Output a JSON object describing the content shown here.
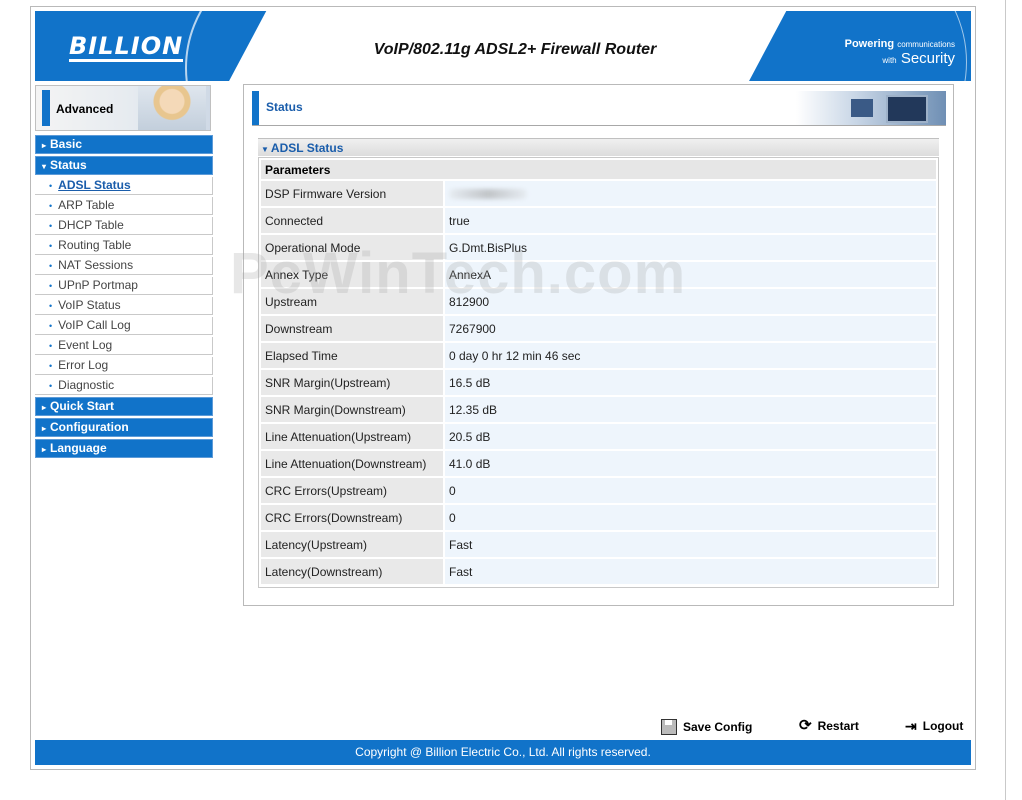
{
  "colors": {
    "brand_blue": "#1173c9",
    "link_blue": "#1a5dab",
    "value_bg": "#eef5fc",
    "label_bg": "#e9e9e9"
  },
  "header": {
    "logo": "BILLION",
    "title": "VoIP/802.11g ADSL2+ Firewall Router",
    "slogan_line1_bold": "Powering",
    "slogan_line1_small": "communications",
    "slogan_line2_small": "with",
    "slogan_line2_big": "Security"
  },
  "sidebar": {
    "mode_label": "Advanced",
    "items": [
      {
        "label": "Basic",
        "type": "main",
        "arrow": "▸"
      },
      {
        "label": "Status",
        "type": "main",
        "arrow": "▾"
      },
      {
        "label": "ADSL Status",
        "type": "sub",
        "active": true
      },
      {
        "label": "ARP Table",
        "type": "sub"
      },
      {
        "label": "DHCP Table",
        "type": "sub"
      },
      {
        "label": "Routing Table",
        "type": "sub"
      },
      {
        "label": "NAT Sessions",
        "type": "sub"
      },
      {
        "label": "UPnP Portmap",
        "type": "sub"
      },
      {
        "label": "VoIP Status",
        "type": "sub"
      },
      {
        "label": "VoIP Call Log",
        "type": "sub"
      },
      {
        "label": "Event Log",
        "type": "sub"
      },
      {
        "label": "Error Log",
        "type": "sub"
      },
      {
        "label": "Diagnostic",
        "type": "sub"
      },
      {
        "label": "Quick Start",
        "type": "main",
        "arrow": "▸"
      },
      {
        "label": "Configuration",
        "type": "main",
        "arrow": "▸"
      },
      {
        "label": "Language",
        "type": "main",
        "arrow": "▸"
      }
    ]
  },
  "main": {
    "page_title": "Status",
    "section_title": "ADSL Status",
    "table_header": "Parameters",
    "rows": [
      {
        "label": "DSP Firmware Version",
        "value": ""
      },
      {
        "label": "Connected",
        "value": "true"
      },
      {
        "label": "Operational Mode",
        "value": "G.Dmt.BisPlus"
      },
      {
        "label": "Annex Type",
        "value": "AnnexA"
      },
      {
        "label": "Upstream",
        "value": "812900"
      },
      {
        "label": "Downstream",
        "value": "7267900"
      },
      {
        "label": "Elapsed Time",
        "value": "0 day 0 hr 12 min 46 sec"
      },
      {
        "label": "SNR Margin(Upstream)",
        "value": "16.5 dB"
      },
      {
        "label": "SNR Margin(Downstream)",
        "value": "12.35 dB"
      },
      {
        "label": "Line Attenuation(Upstream)",
        "value": "20.5 dB"
      },
      {
        "label": "Line Attenuation(Downstream)",
        "value": "41.0 dB"
      },
      {
        "label": "CRC Errors(Upstream)",
        "value": "0"
      },
      {
        "label": "CRC Errors(Downstream)",
        "value": "0"
      },
      {
        "label": "Latency(Upstream)",
        "value": "Fast"
      },
      {
        "label": "Latency(Downstream)",
        "value": "Fast"
      }
    ]
  },
  "watermark": "PcWinTech.com",
  "actions": {
    "save": "Save Config",
    "restart": "Restart",
    "logout": "Logout"
  },
  "footer": {
    "copyright": "Copyright @ Billion Electric Co., Ltd. All rights reserved."
  }
}
